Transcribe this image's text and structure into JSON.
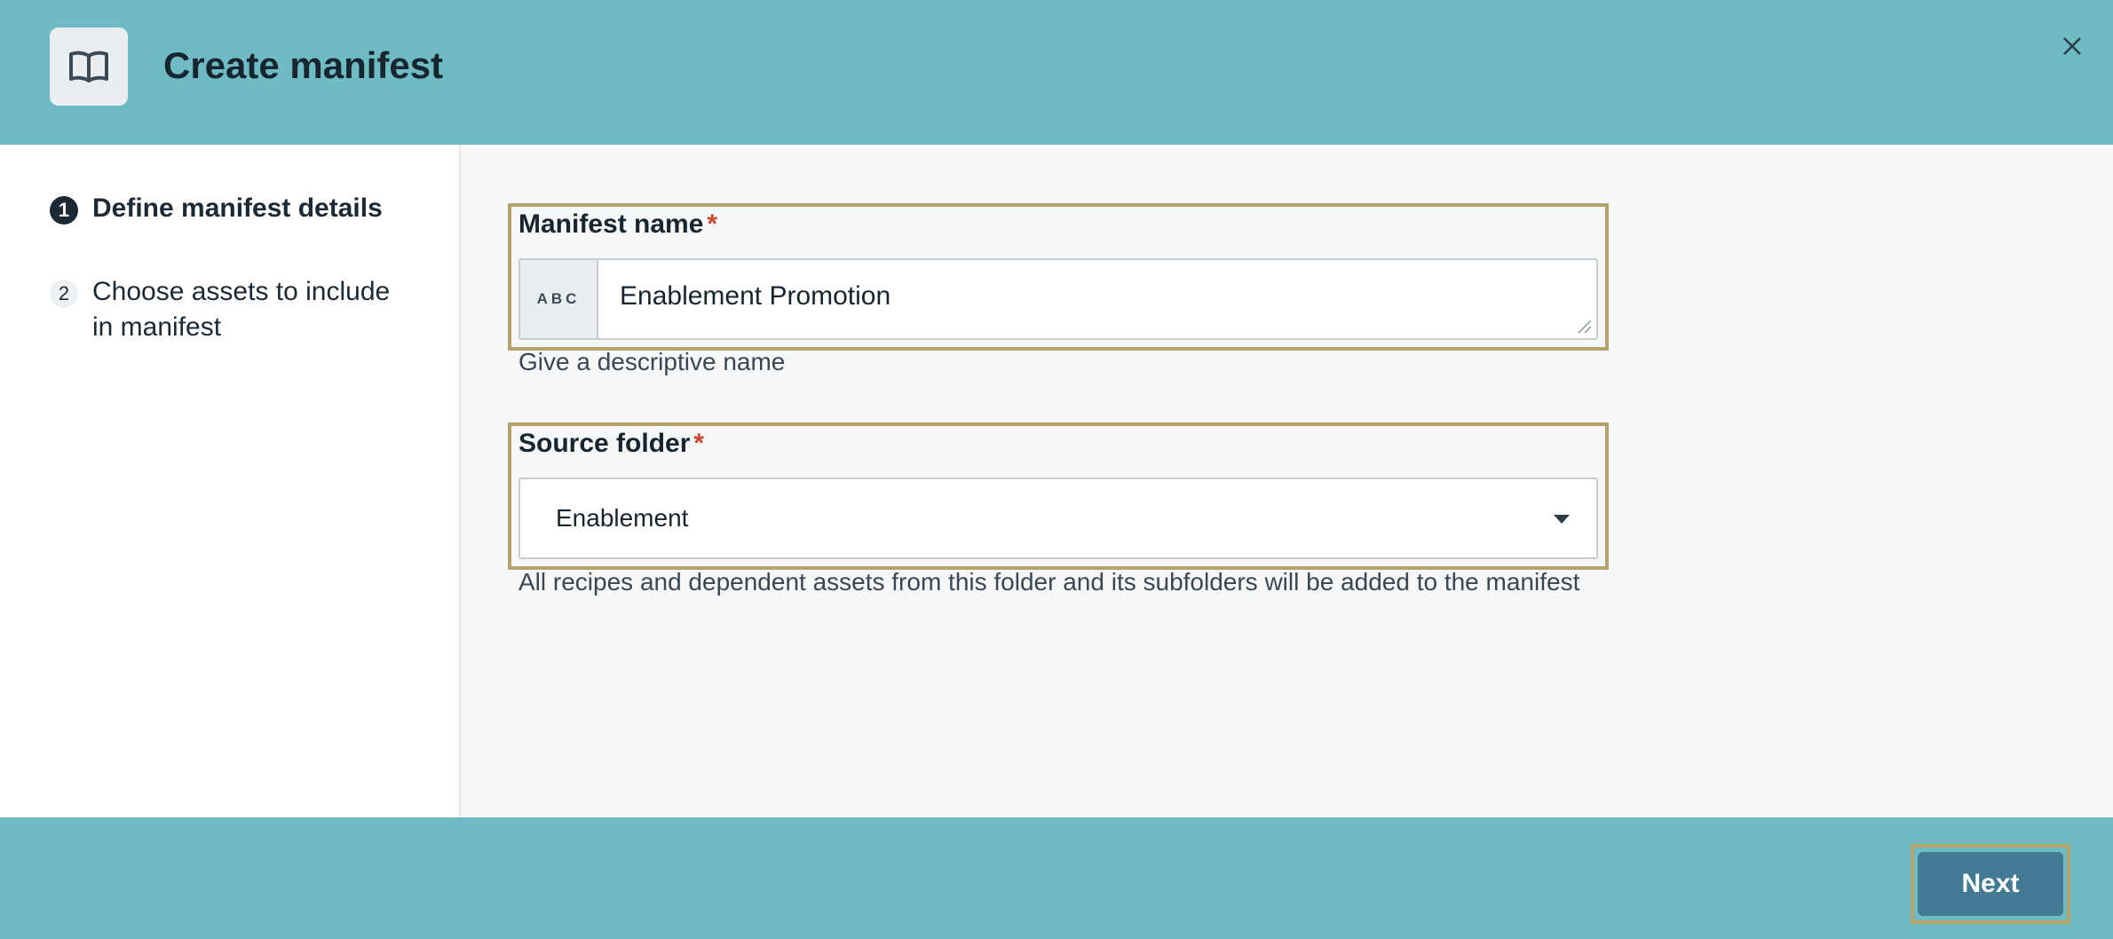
{
  "header": {
    "title": "Create manifest",
    "icon": "book-icon",
    "close_icon": "close-icon"
  },
  "steps": [
    {
      "number": "1",
      "label": "Define manifest details",
      "active": true
    },
    {
      "number": "2",
      "label": "Choose assets to include in manifest",
      "active": false
    }
  ],
  "form": {
    "name_field": {
      "label": "Manifest name",
      "required_mark": "*",
      "type_badge": "ABC",
      "value": "Enablement Promotion",
      "help": "Give a descriptive name"
    },
    "folder_field": {
      "label": "Source folder",
      "required_mark": "*",
      "value": "Enablement",
      "help": "All recipes and dependent assets from this folder and its subfolders will be added to the manifest"
    }
  },
  "footer": {
    "next_label": "Next"
  },
  "colors": {
    "header_bg": "#6fbbc4",
    "accent_button": "#437a93",
    "highlight_outline": "#b5a36a",
    "required": "#c9452f"
  }
}
